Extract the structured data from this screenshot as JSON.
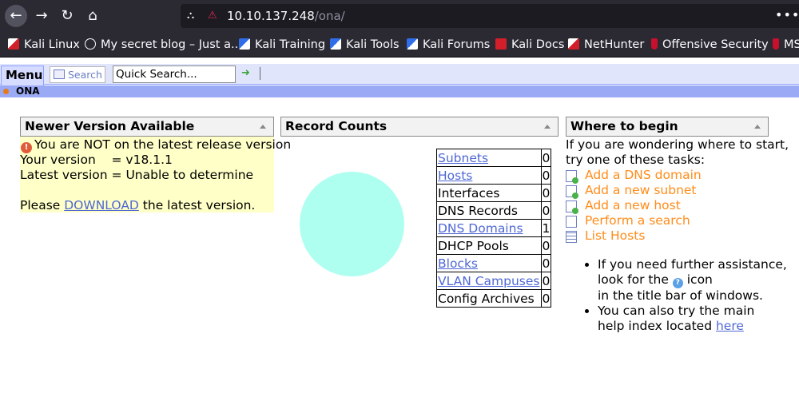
{
  "browser": {
    "url_host": "10.10.137.248",
    "url_path": "/ona/",
    "bookmarks": [
      {
        "label": "Kali Linux",
        "icon": "kali-dragon-icon"
      },
      {
        "label": "My secret blog – Just a...",
        "icon": "globe-icon"
      },
      {
        "label": "Kali Training",
        "icon": "kali-training-icon"
      },
      {
        "label": "Kali Tools",
        "icon": "kali-tools-icon"
      },
      {
        "label": "Kali Forums",
        "icon": "kali-forums-icon"
      },
      {
        "label": "Kali Docs",
        "icon": "kali-docs-icon"
      },
      {
        "label": "NetHunter",
        "icon": "kali-dragon-icon"
      },
      {
        "label": "Offensive Security",
        "icon": "offsec-icon"
      },
      {
        "label": "MS",
        "icon": "offsec-icon"
      }
    ]
  },
  "menubar": {
    "menu_label": "Menu",
    "search_label": "Search",
    "quick_search_placeholder": "Quick Search..."
  },
  "breadcrumb": {
    "label": "ONA"
  },
  "version_panel": {
    "title": "Newer Version Available",
    "warning": "You are NOT on the latest release version",
    "your_version": "Your version    = v18.1.1",
    "latest_version": "Latest version = Unable to determine",
    "please": "Please",
    "download_link": "DOWNLOAD",
    "tail": "the latest version."
  },
  "counts_panel": {
    "title": "Record Counts",
    "rows": [
      {
        "name": "Subnets",
        "value": "0",
        "link": true
      },
      {
        "name": "Hosts",
        "value": "0",
        "link": true
      },
      {
        "name": "Interfaces",
        "value": "0",
        "link": false
      },
      {
        "name": "DNS Records",
        "value": "0",
        "link": false
      },
      {
        "name": "DNS Domains",
        "value": "1",
        "link": true
      },
      {
        "name": "DHCP Pools",
        "value": "0",
        "link": false
      },
      {
        "name": "Blocks",
        "value": "0",
        "link": true
      },
      {
        "name": "VLAN Campuses",
        "value": "0",
        "link": true
      },
      {
        "name": "Config Archives",
        "value": "0",
        "link": false
      }
    ],
    "pie_color": "#aefff0"
  },
  "begin_panel": {
    "title": "Where to begin",
    "intro_1": "If you are wondering where to start,",
    "intro_2": "try one of these tasks:",
    "tasks": [
      {
        "label": "Add a DNS domain",
        "icon": "add-page-icon"
      },
      {
        "label": "Add a new subnet",
        "icon": "add-page-icon"
      },
      {
        "label": "Add a new host",
        "icon": "add-page-icon"
      },
      {
        "label": "Perform a search",
        "icon": "search-window-icon"
      },
      {
        "label": "List Hosts",
        "icon": "list-grid-icon"
      }
    ],
    "help_1a": "If you need further assistance,",
    "help_1b": "look for the",
    "help_1c": "icon",
    "help_1d": "in the title bar of windows.",
    "help_2a": "You can also try the main",
    "help_2b": "help index located",
    "help_2_link": "here"
  },
  "colors": {
    "menubar_bg": "#e1e5fc",
    "breadcrumb_bg": "#9aaaf5",
    "version_bg": "#ffffc8",
    "task_link": "#ff8c1a",
    "link": "#4f68d4"
  }
}
